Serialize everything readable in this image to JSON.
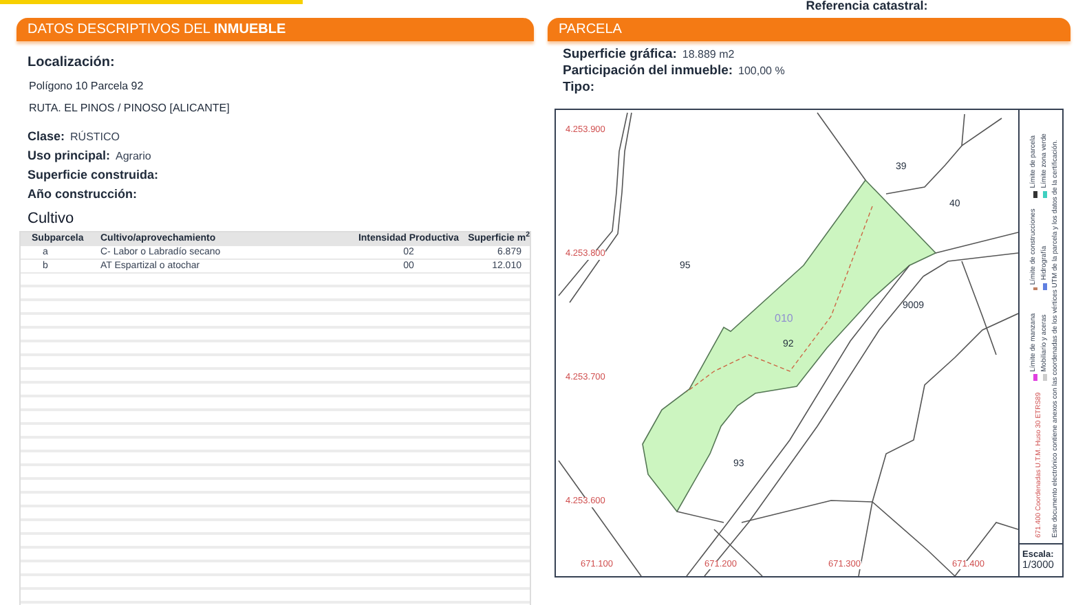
{
  "header": {
    "label": "Referencia catastral:"
  },
  "inmueble": {
    "title": "DATOS DESCRIPTIVOS DEL **INMUEBLE**",
    "location_label": "Localización:",
    "address_lines": [
      "Polígono 10 Parcela 92",
      "RUTA. EL PINOS / PINOSO [ALICANTE]"
    ],
    "fields": [
      {
        "label": "Clase:",
        "value": "RÚSTICO"
      },
      {
        "label": "Uso principal:",
        "value": "Agrario"
      },
      {
        "label": "Superficie construida:"
      },
      {
        "label": "Año construcción:"
      }
    ],
    "cultivo": {
      "title": "Cultivo",
      "columns": [
        "Subparcela",
        "Cultivo/aprovechamiento",
        "Intensidad Productiva",
        "Superficie m$^{2}$"
      ],
      "rows": [
        [
          "a",
          "C- Labor o Labradío secano",
          "02",
          "6.879"
        ],
        [
          "b",
          "AT Espartizal o atochar",
          "00",
          "12.010"
        ]
      ]
    }
  },
  "parcela": {
    "title": "PARCELA",
    "fields": [
      {
        "label": "Superficie gráfica:",
        "value": "18.889 m2"
      },
      {
        "label": "Participación del inmueble:",
        "value": "100,00 %"
      },
      {
        "label": "Tipo:"
      }
    ],
    "map": {
      "y_labels": [
        "4.253.900",
        "4.253.800",
        "4.253.700",
        "4.253.600"
      ],
      "x_labels": [
        "671.100",
        "671.200",
        "671.300",
        "671.400"
      ],
      "parcel_labels": [
        "39",
        "40",
        "95",
        "9009",
        "92",
        "93"
      ],
      "zone_code": "010",
      "legend": [
        {
          "label": "Límite de manzana",
          "color": "#e040e0"
        },
        {
          "label": "Límite de construcciones",
          "color": "#c08060"
        },
        {
          "label": "Límite de parcela",
          "color": "#333333"
        },
        {
          "label": "Mobiliario y aceras",
          "color": "#cccccc"
        },
        {
          "label": "Hidrografía",
          "color": "#6080e0"
        },
        {
          "label": "Límite zona verde",
          "color": "#40d0c0"
        }
      ],
      "coordinate_note": "671.400 Coordenadas U.T.M. Huso 30 ETRS89",
      "note": "Este documento electrónico contiene anexos con las coordenadas de los vértices UTM de la parcela y los datos de la certificación.",
      "scale_label": "Escala:",
      "scale": "1/3000"
    }
  }
}
